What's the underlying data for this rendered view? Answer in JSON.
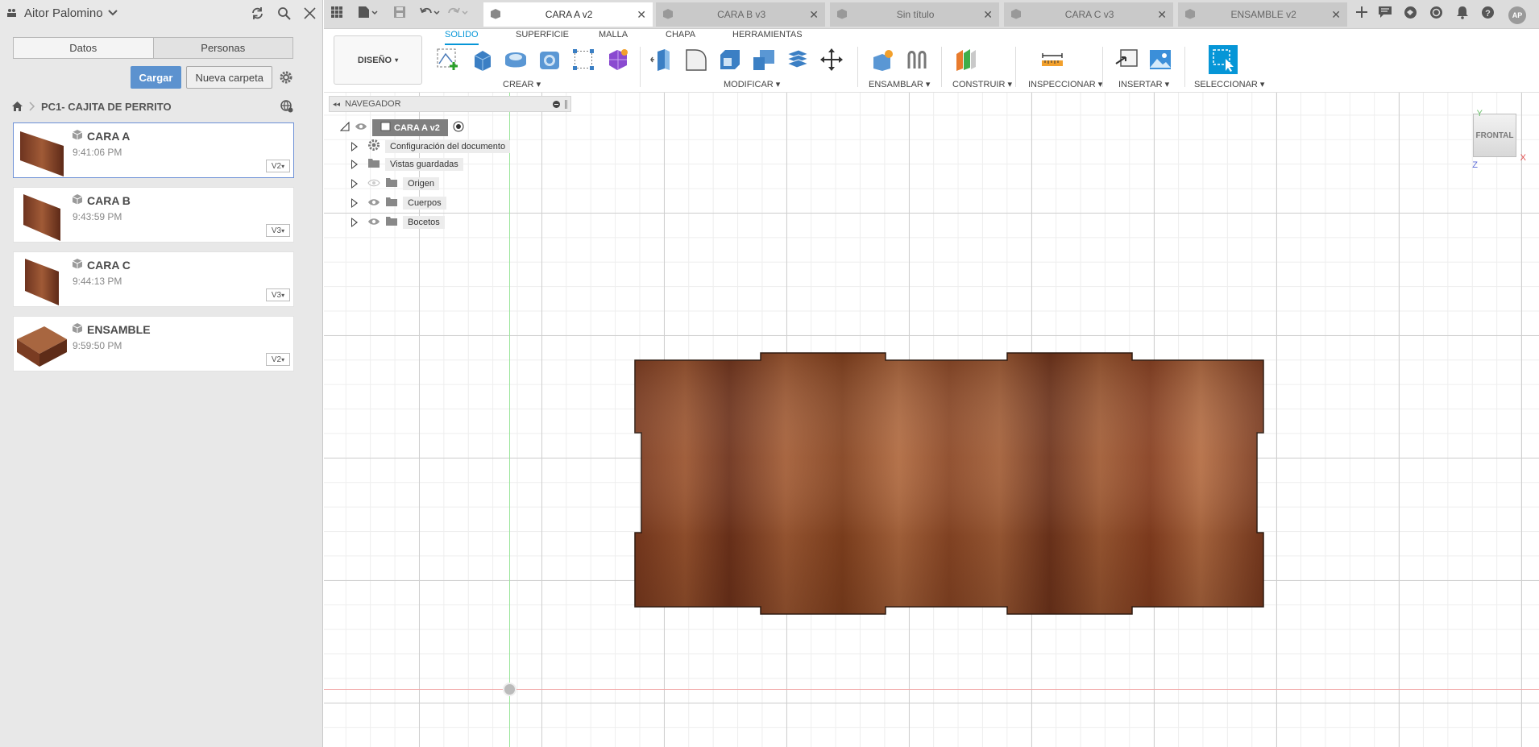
{
  "left_panel": {
    "user_name": "Aitor Palomino",
    "tabs": [
      "Datos",
      "Personas"
    ],
    "upload_label": "Cargar",
    "new_folder_label": "Nueva carpeta",
    "breadcrumb": "PC1- CAJITA DE PERRITO",
    "files": [
      {
        "name": "CARA A",
        "time": "9:41:06 PM",
        "version": "V2"
      },
      {
        "name": "CARA B",
        "time": "9:43:59 PM",
        "version": "V3"
      },
      {
        "name": "CARA C",
        "time": "9:44:13 PM",
        "version": "V3"
      },
      {
        "name": "ENSAMBLE",
        "time": "9:59:50 PM",
        "version": "V2"
      }
    ]
  },
  "doc_tabs": [
    {
      "label": "CARA A v2",
      "active": true
    },
    {
      "label": "CARA B v3",
      "active": false
    },
    {
      "label": "Sin título",
      "active": false
    },
    {
      "label": "CARA C v3",
      "active": false
    },
    {
      "label": "ENSAMBLE v2",
      "active": false
    }
  ],
  "user_initials": "AP",
  "toolbar": {
    "workspace": "DISEÑO",
    "tabs": [
      "SOLIDO",
      "SUPERFICIE",
      "MALLA",
      "CHAPA",
      "HERRAMIENTAS"
    ],
    "groups": [
      "CREAR",
      "MODIFICAR",
      "ENSAMBLAR",
      "CONSTRUIR",
      "INSPECCIONAR",
      "INSERTAR",
      "SELECCIONAR"
    ]
  },
  "navigator": {
    "title": "NAVEGADOR",
    "root": "CARA A v2",
    "items": [
      "Configuración del documento",
      "Vistas guardadas",
      "Origen",
      "Cuerpos",
      "Bocetos"
    ]
  },
  "viewcube": {
    "face": "FRONTAL",
    "axis_y": "Y",
    "axis_x": "X",
    "axis_z": "Z"
  },
  "colors": {
    "accent": "#0696d7",
    "primary_button": "#5c92cf",
    "wood": "#8a4a28"
  }
}
